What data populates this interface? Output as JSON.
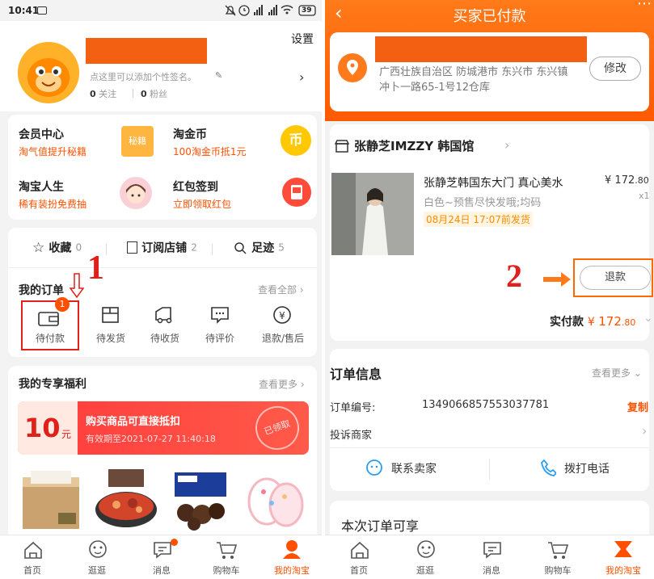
{
  "status_bar": {
    "time": "10:41",
    "battery": "39"
  },
  "left": {
    "settings": "设置",
    "signature": "点这里可以添加个性签名。",
    "follow_count": "0",
    "follow_label": "关注",
    "fans_count": "0",
    "fans_label": "粉丝",
    "services": [
      {
        "title": "会员中心",
        "subtitle": "淘气值提升秘籍",
        "icon_text": "秘籍"
      },
      {
        "title": "淘金币",
        "subtitle": "100淘金币抵1元",
        "icon_text": "币"
      },
      {
        "title": "淘宝人生",
        "subtitle": "稀有装扮免费抽"
      },
      {
        "title": "红包签到",
        "subtitle": "立即领取红包"
      }
    ],
    "quick_links": [
      {
        "label": "收藏",
        "count": "0"
      },
      {
        "label": "订阅店铺",
        "count": "2"
      },
      {
        "label": "足迹",
        "count": "5"
      }
    ],
    "orders_title": "我的订单",
    "view_all": "查看全部",
    "annotation_1": "1",
    "order_items": [
      {
        "label": "待付款",
        "badge": "1"
      },
      {
        "label": "待发货"
      },
      {
        "label": "待收货"
      },
      {
        "label": "待评价"
      },
      {
        "label": "退款/售后"
      }
    ],
    "benefits_title": "我的专享福利",
    "view_more": "查看更多",
    "coupon": {
      "amount": "10",
      "unit": "元",
      "title": "购买商品可直接抵扣",
      "validity": "有效期至2021-07-27 11:40:18",
      "stamp": "已领取"
    },
    "tabbar": [
      "首页",
      "逛逛",
      "消息",
      "购物车",
      "我的淘宝"
    ]
  },
  "right": {
    "title": "买家已付款",
    "address": "广西壮族自治区 防城港市 东兴市 东兴镇 冲卜一路65-1号12仓库",
    "modify": "修改",
    "shop_name": "张静芝IMZZY 韩国馆",
    "product_title": "张静芝韩国东大门 真心美水",
    "product_spec": "白色~预售尽快发哦;均码",
    "ship_time": "08月24日 17:07前发货",
    "price_symbol": "¥",
    "price_int": "172",
    "price_dec": ".80",
    "quantity": "x1",
    "annotation_2": "2",
    "refund": "退款",
    "paid_label": "实付款",
    "paid_int": "172",
    "paid_dec": ".80",
    "order_info_title": "订单信息",
    "view_more": "查看更多",
    "order_no_label": "订单编号:",
    "order_no": "1349066857553037781",
    "copy": "复制",
    "complaint": "投诉商家",
    "contact_seller": "联系卖家",
    "call_phone": "拨打电话",
    "benefit_section": "本次订单可享",
    "tabbar": [
      "首页",
      "逛逛",
      "消息",
      "购物车",
      "我的淘宝"
    ]
  },
  "colors": {
    "orange": "#ff5000",
    "annotation_red": "#e0201a",
    "highlight_box": "#ff6a00",
    "price": "#ff5000"
  }
}
